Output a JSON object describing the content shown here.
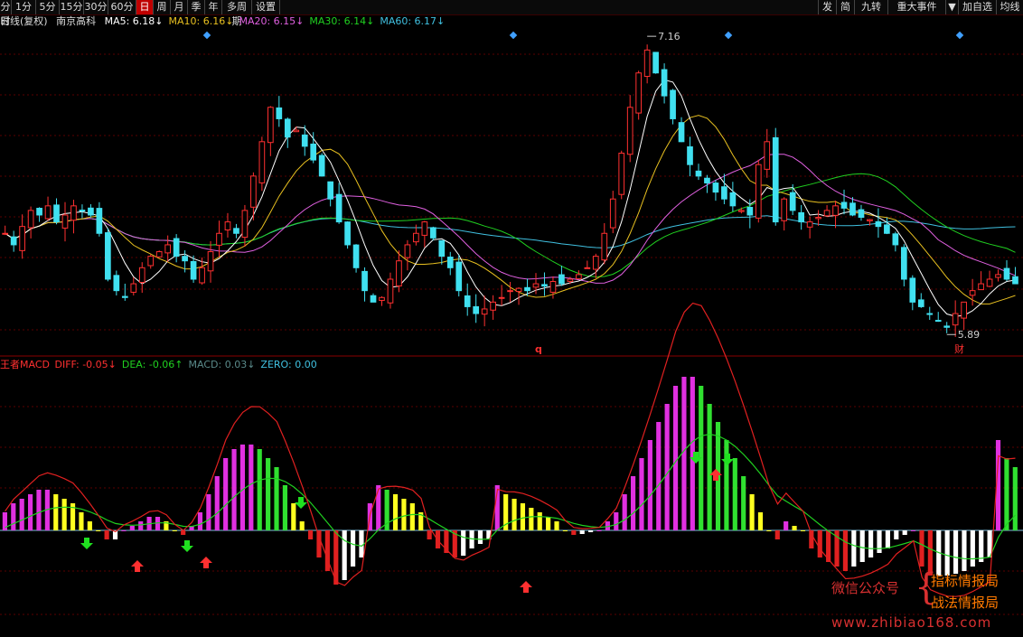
{
  "toolbar": {
    "left": [
      "分时",
      "1分",
      "5分",
      "15分",
      "30分",
      "60分",
      "日",
      "周",
      "月",
      "季",
      "年",
      "多周期",
      "设置"
    ],
    "active": "日",
    "right": [
      "发",
      "简",
      "九转",
      "重大事件",
      "▼",
      "加自选",
      "均线"
    ]
  },
  "legend": {
    "main_prefix": "日线(复权)",
    "stock_name": "南京高科",
    "ma": [
      {
        "label": "MA5: 6.18",
        "arrow": "↓",
        "color": "#ffffff"
      },
      {
        "label": "MA10: 6.16",
        "arrow": "↓",
        "color": "#e8c020"
      },
      {
        "label": "MA20: 6.15",
        "arrow": "↓",
        "color": "#e060e0"
      },
      {
        "label": "MA30: 6.14",
        "arrow": "↓",
        "color": "#20d020"
      },
      {
        "label": "MA60: 6.17",
        "arrow": "↓",
        "color": "#40c0e0"
      }
    ],
    "macd_prefix": "王者MACD",
    "macd": [
      {
        "label": "DIFF: -0.05",
        "arrow": "↓",
        "color": "#ff3030"
      },
      {
        "label": "DEA: -0.06",
        "arrow": "↑",
        "color": "#20d020"
      },
      {
        "label": "MACD: 0.03",
        "arrow": "↓",
        "color": "#5a8a8a"
      },
      {
        "label": "ZERO: 0.00",
        "arrow": "",
        "color": "#40c0e0"
      }
    ]
  },
  "annotations": {
    "high_label": "7.16",
    "low_label": "5.89",
    "q_marker": "q",
    "cai_marker": "财"
  },
  "watermark": {
    "wechat": "微信公众号",
    "name1": "指标情报局",
    "name2": "战法情报局",
    "site": "www.zhibiao168.com"
  },
  "colors": {
    "up": "#ff3030",
    "down": "#40e0f0",
    "grid": "#5a0000",
    "macd_pos_up": "#e030e0",
    "macd_pos_down": "#30e030",
    "macd_neg_up": "#ffffff",
    "macd_neg_down": "#e02020",
    "yellow_bar": "#ffff20"
  },
  "chart_data": {
    "type": "candlestick",
    "symbol": "南京高科",
    "price_high": 7.16,
    "price_low": 5.89,
    "overlays": [
      "MA5",
      "MA10",
      "MA20",
      "MA30",
      "MA60"
    ],
    "indicator": "MACD",
    "last": {
      "MA5": 6.18,
      "MA10": 6.16,
      "MA20": 6.15,
      "MA30": 6.14,
      "MA60": 6.17,
      "DIFF": -0.05,
      "DEA": -0.06,
      "MACD": 0.03,
      "ZERO": 0.0
    },
    "close_series": [
      6.3,
      6.25,
      6.33,
      6.4,
      6.38,
      6.42,
      6.35,
      6.38,
      6.42,
      6.4,
      6.38,
      6.3,
      6.1,
      6.05,
      6.02,
      6.08,
      6.15,
      6.2,
      6.22,
      6.25,
      6.2,
      6.18,
      6.1,
      6.15,
      6.22,
      6.3,
      6.35,
      6.3,
      6.4,
      6.55,
      6.7,
      6.85,
      6.8,
      6.72,
      6.75,
      6.68,
      6.62,
      6.55,
      6.45,
      6.35,
      6.25,
      6.15,
      6.05,
      6.0,
      6.02,
      6.1,
      6.18,
      6.25,
      6.3,
      6.35,
      6.28,
      6.2,
      6.15,
      6.05,
      5.98,
      5.95,
      5.97,
      6.0,
      6.02,
      6.05,
      6.06,
      6.05,
      6.08,
      6.07,
      6.09,
      6.08,
      6.1,
      6.12,
      6.15,
      6.2,
      6.3,
      6.45,
      6.65,
      6.85,
      7.0,
      7.1,
      7.0,
      6.9,
      6.8,
      6.7,
      6.6,
      6.55,
      6.52,
      6.48,
      6.45,
      6.42,
      6.4,
      6.38,
      6.6,
      6.7,
      6.35,
      6.45,
      6.4,
      6.35,
      6.35,
      6.37,
      6.4,
      6.42,
      6.41,
      6.38,
      6.37,
      6.36,
      6.33,
      6.3,
      6.25,
      6.1,
      6.0,
      5.98,
      5.95,
      5.92,
      5.89,
      5.95,
      6.0,
      6.05,
      6.08,
      6.1,
      6.12,
      6.1,
      6.08
    ],
    "macd_hist": [
      0.02,
      0.03,
      0.035,
      0.04,
      0.045,
      0.045,
      0.04,
      0.035,
      0.03,
      0.02,
      0.01,
      0.0,
      -0.01,
      -0.01,
      0.0,
      0.005,
      0.01,
      0.015,
      0.015,
      0.01,
      0.0,
      -0.005,
      0.005,
      0.02,
      0.04,
      0.06,
      0.08,
      0.09,
      0.095,
      0.095,
      0.09,
      0.08,
      0.07,
      0.05,
      0.03,
      0.01,
      -0.01,
      -0.03,
      -0.045,
      -0.06,
      -0.055,
      -0.04,
      -0.03,
      0.03,
      0.05,
      0.045,
      0.04,
      0.035,
      0.03,
      0.02,
      -0.01,
      -0.02,
      -0.025,
      -0.03,
      -0.028,
      -0.02,
      -0.015,
      -0.01,
      0.05,
      0.04,
      0.035,
      0.03,
      0.025,
      0.02,
      0.015,
      0.01,
      0.0,
      -0.005,
      -0.004,
      -0.002,
      0.0,
      0.01,
      0.02,
      0.04,
      0.06,
      0.08,
      0.1,
      0.12,
      0.14,
      0.16,
      0.17,
      0.17,
      0.16,
      0.14,
      0.12,
      0.1,
      0.08,
      0.06,
      0.04,
      0.02,
      0.0,
      -0.01,
      0.01,
      0.005,
      0.0,
      -0.02,
      -0.03,
      -0.035,
      -0.04,
      -0.045,
      -0.04,
      -0.035,
      -0.03,
      -0.025,
      -0.02,
      -0.01,
      -0.005,
      0.0,
      -0.04,
      -0.05,
      -0.05,
      -0.05,
      -0.048,
      -0.045,
      -0.04,
      -0.035,
      -0.03,
      0.1,
      0.08,
      0.07
    ]
  }
}
